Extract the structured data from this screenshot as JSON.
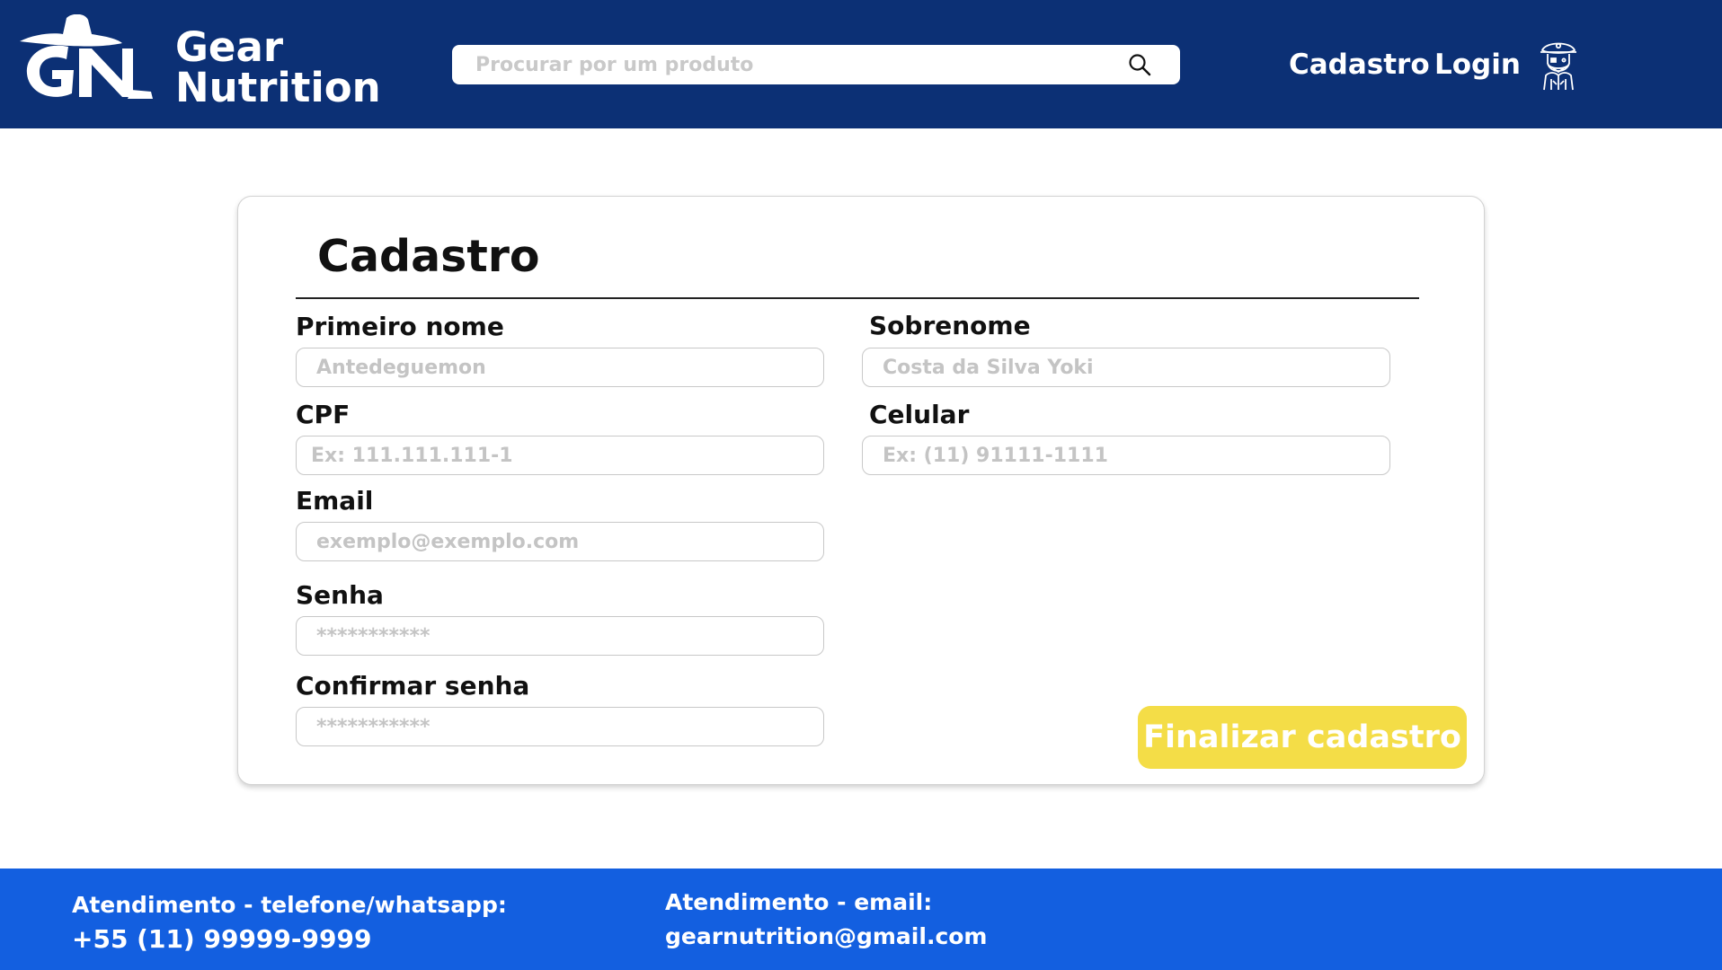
{
  "brand": {
    "initials": "GN",
    "name_line1": "Gear",
    "name_line2": "Nutrition"
  },
  "search": {
    "placeholder": "Procurar por um produto",
    "icon": "search-icon"
  },
  "nav": {
    "cadastro_label": "Cadastro",
    "login_label": "Login",
    "user_icon": "pirate-user-icon"
  },
  "form": {
    "title": "Cadastro",
    "first_name": {
      "label": "Primeiro nome",
      "placeholder": "Antedeguemon"
    },
    "last_name": {
      "label": "Sobrenome",
      "placeholder": "Costa da Silva Yoki"
    },
    "cpf": {
      "label": "CPF",
      "placeholder": "Ex: 111.111.111-1"
    },
    "phone": {
      "label": "Celular",
      "placeholder": "Ex: (11) 91111-1111"
    },
    "email": {
      "label": "Email",
      "placeholder": "exemplo@exemplo.com"
    },
    "password": {
      "label": "Senha",
      "placeholder": "***********"
    },
    "confirm_password": {
      "label": "Confirmar senha",
      "placeholder": "***********"
    },
    "submit_label": "Finalizar cadastro"
  },
  "footer": {
    "phone_title": "Atendimento - telefone/whatsapp:",
    "phone_value": "+55 (11) 99999-9999",
    "email_title": "Atendimento - email:",
    "email_value": "gearnutrition@gmail.com"
  },
  "colors": {
    "header_bg": "#0c3075",
    "footer_bg": "#135fe0",
    "accent_button": "#f4dd47"
  }
}
